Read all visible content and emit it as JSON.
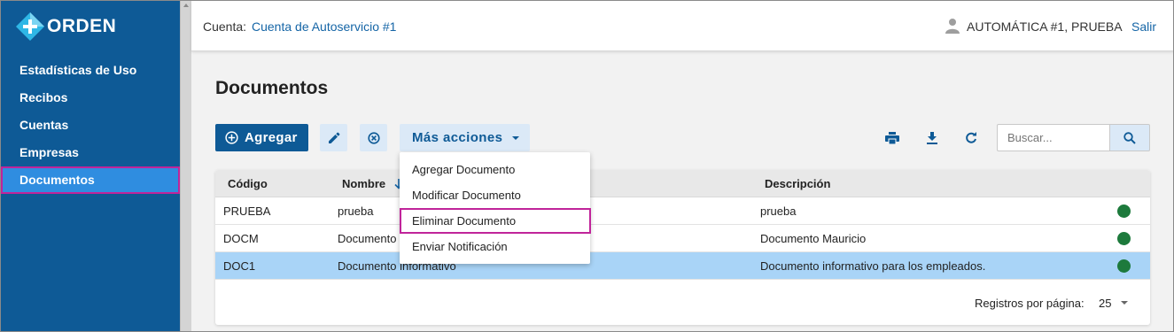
{
  "app": {
    "logo_text": "ORDEN"
  },
  "sidebar": {
    "items": [
      {
        "label": "Estadísticas de Uso"
      },
      {
        "label": "Recibos"
      },
      {
        "label": "Cuentas"
      },
      {
        "label": "Empresas"
      },
      {
        "label": "Documentos",
        "active": true
      }
    ]
  },
  "header": {
    "account_label": "Cuenta:",
    "account_value": "Cuenta de Autoservicio #1",
    "user_name": "AUTOMÁTICA #1, PRUEBA",
    "logout_label": "Salir"
  },
  "page": {
    "title": "Documentos"
  },
  "toolbar": {
    "add_label": "Agregar",
    "more_actions_label": "Más acciones",
    "search_placeholder": "Buscar...",
    "icons": [
      "edit-icon",
      "cancel-icon",
      "print-icon",
      "download-icon",
      "refresh-icon",
      "search-icon"
    ]
  },
  "dropdown": {
    "items": [
      {
        "label": "Agregar Documento"
      },
      {
        "label": "Modificar Documento"
      },
      {
        "label": "Eliminar Documento",
        "highlighted": true
      },
      {
        "label": "Enviar Notificación"
      }
    ]
  },
  "table": {
    "columns": [
      "Código",
      "Nombre",
      "Descripción"
    ],
    "sorted_column": "Nombre",
    "rows": [
      {
        "code": "PRUEBA",
        "name": "prueba",
        "description": "prueba",
        "status": "active"
      },
      {
        "code": "DOCM",
        "name": "Documento Mauricio",
        "description": "Documento Mauricio",
        "status": "active"
      },
      {
        "code": "DOC1",
        "name": "Documento informativo",
        "description": "Documento informativo para los empleados.",
        "status": "active",
        "selected": true
      }
    ]
  },
  "pagination": {
    "label": "Registros por página:",
    "value": "25"
  },
  "colors": {
    "primary": "#0e5a96",
    "sidebar_active": "#2f8de0",
    "highlight_border": "#c0249a",
    "status_active": "#1d7a3c",
    "row_selected": "#a9d4f7"
  }
}
